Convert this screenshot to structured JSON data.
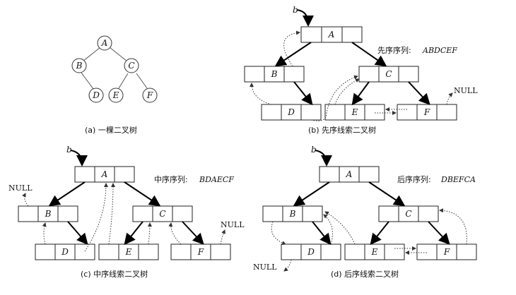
{
  "tree": {
    "nodes": [
      "A",
      "B",
      "C",
      "D",
      "E",
      "F"
    ]
  },
  "captions": {
    "a": "(a)  一棵二叉树",
    "b": "(b)  先序线索二叉树",
    "c": "(c)  中序线索二叉树",
    "d": "(d)  后序线索二叉树"
  },
  "sequences": {
    "pre_label": "先序序列:",
    "pre_value": "ABDCEF",
    "in_label": "中序序列:",
    "in_value": "BDAECF",
    "post_label": "后序序列:",
    "post_value": "DBEFCA"
  },
  "root_pointer": "b",
  "null_label": "NULL"
}
